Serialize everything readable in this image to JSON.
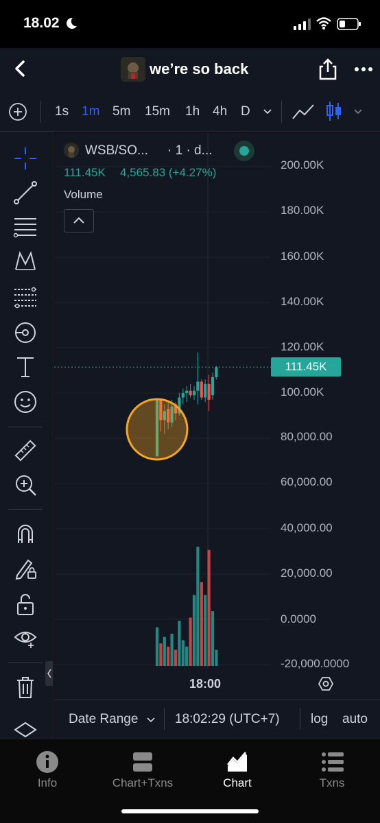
{
  "status": {
    "time": "18.02"
  },
  "header": {
    "title": "we’re so back"
  },
  "timeframes": [
    "1s",
    "1m",
    "5m",
    "15m",
    "1h",
    "4h",
    "D"
  ],
  "active_timeframe": "1m",
  "legend": {
    "symbol": "WSB/SO...",
    "interval": "· 1 · d...",
    "price": "111.45K",
    "change": "4,565.83 (+4.27%)",
    "volume_label": "Volume"
  },
  "price_axis": [
    "200.00K",
    "180.00K",
    "160.00K",
    "140.00K",
    "120.00K",
    "100.00K",
    "80,000.00",
    "60,000.00",
    "40,000.00",
    "20,000.00",
    "0.0000",
    "-20,000.0000"
  ],
  "current_price_badge": "111.45K",
  "time_axis": {
    "label": "18:00"
  },
  "range_bar": {
    "date_range": "Date Range",
    "time": "18:02:29 (UTC+7)",
    "log": "log",
    "auto": "auto"
  },
  "nav": [
    {
      "label": "Info"
    },
    {
      "label": "Chart+Txns"
    },
    {
      "label": "Chart"
    },
    {
      "label": "Txns"
    }
  ],
  "active_nav": "Chart",
  "colors": {
    "up": "#26a69a",
    "down": "#ef5350",
    "accent": "#2962ff",
    "highlight": "#f5a623"
  },
  "chart_data": {
    "type": "candlestick",
    "y_range": [
      -20000,
      200000
    ],
    "candles": [
      {
        "open": 72000,
        "high": 97000,
        "low": 72000,
        "close": 97000,
        "volume": 12000
      },
      {
        "open": 97000,
        "high": 97000,
        "low": 83000,
        "close": 88000,
        "volume": 7000
      },
      {
        "open": 88000,
        "high": 95000,
        "low": 82000,
        "close": 92000,
        "volume": 9000
      },
      {
        "open": 93000,
        "high": 96000,
        "low": 84000,
        "close": 87000,
        "volume": 6000
      },
      {
        "open": 87000,
        "high": 97000,
        "low": 85000,
        "close": 94000,
        "volume": 10000
      },
      {
        "open": 95000,
        "high": 96000,
        "low": 88000,
        "close": 91000,
        "volume": 5000
      },
      {
        "open": 91000,
        "high": 100000,
        "low": 90000,
        "close": 98000,
        "volume": 14000
      },
      {
        "open": 98000,
        "high": 102000,
        "low": 95000,
        "close": 100000,
        "volume": 8000
      },
      {
        "open": 100000,
        "high": 103000,
        "low": 96000,
        "close": 101000,
        "volume": 6000
      },
      {
        "open": 101000,
        "high": 104000,
        "low": 98000,
        "close": 99000,
        "volume": 15000
      },
      {
        "open": 99000,
        "high": 103000,
        "low": 97000,
        "close": 101000,
        "volume": 22000
      },
      {
        "open": 101000,
        "high": 118000,
        "low": 95000,
        "close": 105000,
        "volume": 37000
      },
      {
        "open": 105000,
        "high": 106000,
        "low": 97000,
        "close": 98000,
        "volume": 26000
      },
      {
        "open": 98000,
        "high": 106000,
        "low": 96000,
        "close": 104000,
        "volume": 22000
      },
      {
        "open": 104000,
        "high": 108000,
        "low": 92000,
        "close": 97000,
        "volume": 36000
      },
      {
        "open": 99000,
        "high": 109000,
        "low": 97000,
        "close": 107000,
        "volume": 17000
      },
      {
        "open": 107000,
        "high": 112000,
        "low": 106000,
        "close": 111450,
        "volume": 5000
      }
    ]
  }
}
